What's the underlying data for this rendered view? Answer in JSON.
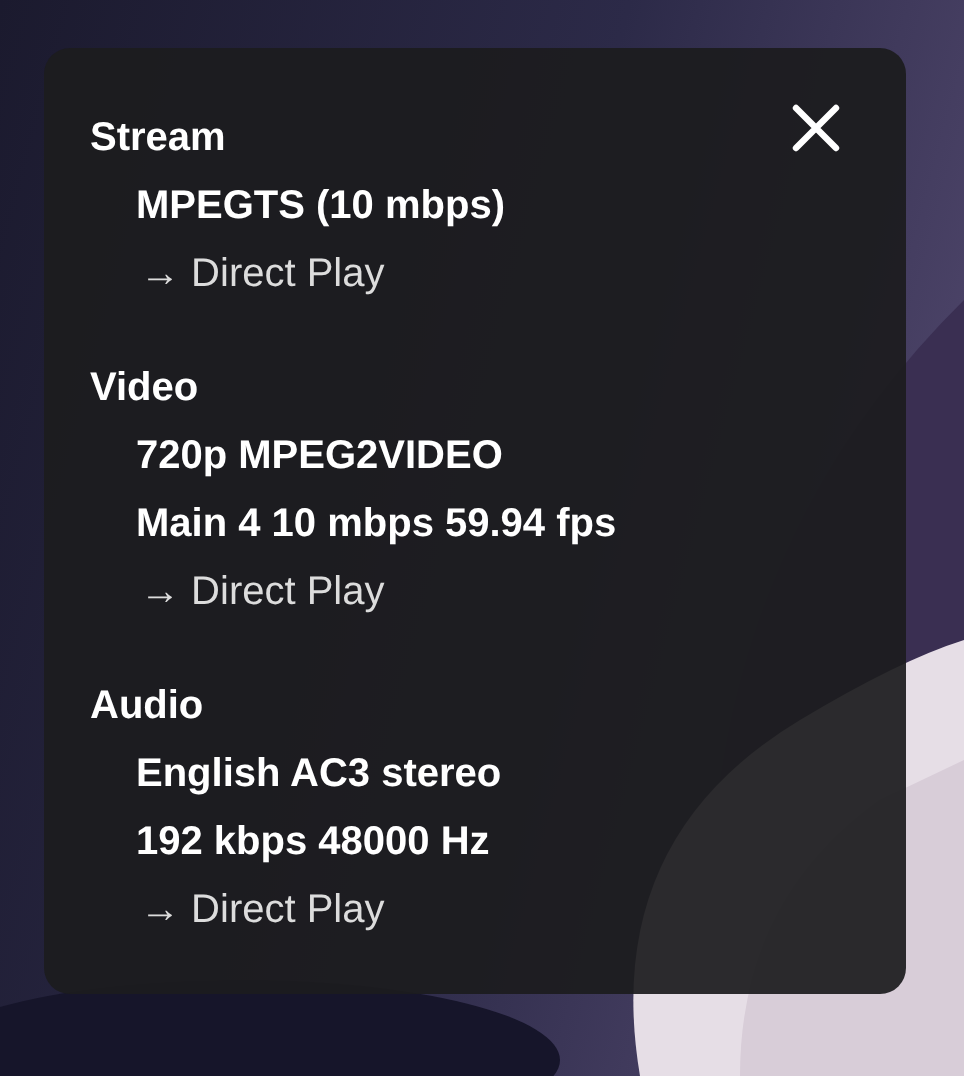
{
  "sections": [
    {
      "title": "Stream",
      "lines": [
        {
          "kind": "detail",
          "text": "MPEGTS (10 mbps)"
        },
        {
          "kind": "method",
          "text": "→ Direct Play"
        }
      ]
    },
    {
      "title": "Video",
      "lines": [
        {
          "kind": "detail",
          "text": "720p MPEG2VIDEO"
        },
        {
          "kind": "detail",
          "text": "Main 4 10 mbps 59.94 fps"
        },
        {
          "kind": "method",
          "text": "→ Direct Play"
        }
      ]
    },
    {
      "title": "Audio",
      "lines": [
        {
          "kind": "detail",
          "text": "English AC3 stereo"
        },
        {
          "kind": "detail",
          "text": "192 kbps 48000 Hz"
        },
        {
          "kind": "method",
          "text": "→ Direct Play"
        }
      ]
    }
  ]
}
